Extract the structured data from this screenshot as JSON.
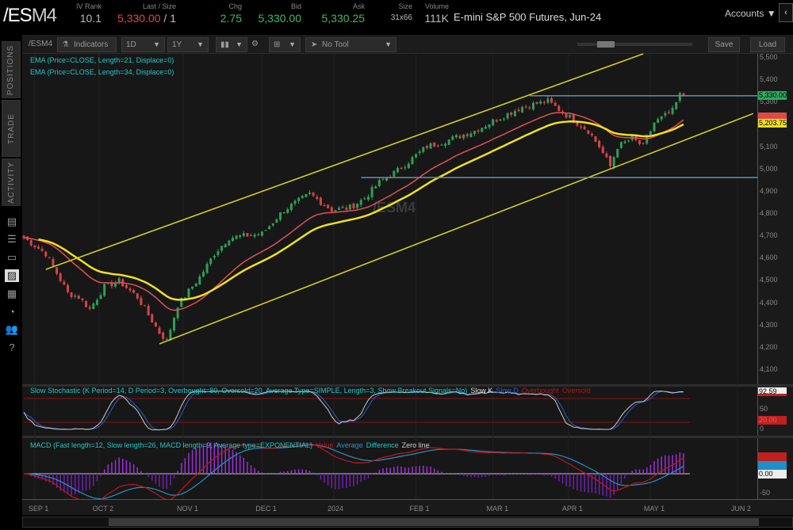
{
  "header": {
    "symbol_prefix": "/ES",
    "symbol_suffix": "M4",
    "fields": [
      {
        "label": "IV Rank",
        "value": "10.1"
      },
      {
        "label": "Last / Size",
        "value": "5,330.00",
        "suffix": " / 1"
      },
      {
        "label": "Chg",
        "value": "2.75"
      },
      {
        "label": "Bid",
        "value": "5,330.00"
      },
      {
        "label": "Ask",
        "value": "5,330.25"
      },
      {
        "label": "Size",
        "value": "31x66"
      },
      {
        "label": "Volume",
        "value": "111K"
      }
    ],
    "description": "E-mini S&P 500 Futures, Jun-24",
    "accounts": "Accounts"
  },
  "sidebar": {
    "tabs": [
      "POSITIONS",
      "TRADE",
      "ACTIVITY"
    ]
  },
  "toolbar": {
    "symbol": "/ESM4",
    "indicators": "Indicators",
    "aggregation": "1D",
    "range": "1Y",
    "tool": "No Tool",
    "save": "Save",
    "load": "Load"
  },
  "studies": {
    "ema21": "EMA (Price=CLOSE, Length=21, Displace=0)",
    "ema34": "EMA (Price=CLOSE, Length=34, Displace=0)",
    "stoch": "Slow Stochastic (K Period=14, D Period=3, Overbought=80, Oversold=20, Average Type=SIMPLE, Length=3, Show Breakout Signals=No)",
    "stoch_legend": [
      "Slow K",
      "Slow D",
      "Overbought",
      "Oversold"
    ],
    "macd": "MACD (Fast length=12, Slow length=26, MACD length=9, Average type=EXPONENTIAL)",
    "macd_legend": [
      "Value",
      "Average",
      "Difference",
      "Zero line"
    ],
    "watermark": "/ESM4"
  },
  "colors": {
    "up": "#2e9e5b",
    "down": "#d9434b",
    "ema21": "#e0505a",
    "ema34": "#f0e020",
    "channel": "#d8d820",
    "hline": "#6a90a8"
  },
  "chart_data": {
    "type": "candlestick",
    "x_unit": "trading day index",
    "close_keypoints": [
      [
        0,
        4693
      ],
      [
        6,
        4622
      ],
      [
        12,
        4445
      ],
      [
        15,
        4427
      ],
      [
        18,
        4373
      ],
      [
        22,
        4473
      ],
      [
        26,
        4498
      ],
      [
        31,
        4427
      ],
      [
        37,
        4267
      ],
      [
        39,
        4231
      ],
      [
        42,
        4391
      ],
      [
        48,
        4516
      ],
      [
        52,
        4622
      ],
      [
        56,
        4693
      ],
      [
        65,
        4711
      ],
      [
        71,
        4818
      ],
      [
        78,
        4889
      ],
      [
        84,
        4818
      ],
      [
        89,
        4828
      ],
      [
        93,
        4871
      ],
      [
        97,
        4942
      ],
      [
        102,
        4995
      ],
      [
        106,
        5049
      ],
      [
        110,
        5102
      ],
      [
        117,
        5138
      ],
      [
        123,
        5173
      ],
      [
        130,
        5233
      ],
      [
        136,
        5280
      ],
      [
        143,
        5305
      ],
      [
        148,
        5244
      ],
      [
        154,
        5173
      ],
      [
        157,
        5102
      ],
      [
        160,
        5013
      ],
      [
        162,
        5102
      ],
      [
        166,
        5138
      ],
      [
        169,
        5102
      ],
      [
        172,
        5209
      ],
      [
        177,
        5262
      ],
      [
        179,
        5333
      ],
      [
        180,
        5330
      ]
    ],
    "price_axis": {
      "ticks": [
        "5,500",
        "5,400",
        "5,300",
        "5,100",
        "5,000",
        "4,900",
        "4,800",
        "4,700",
        "4,600",
        "4,500",
        "4,400",
        "4,300",
        "4,200",
        "4,100"
      ],
      "range": [
        4070,
        5520
      ]
    },
    "price_tags": {
      "last": "5,330.00",
      "ema34": "5,203.75"
    },
    "date_ticks": [
      {
        "label": "SEP 1",
        "day": 3
      },
      {
        "label": "OCT 2",
        "day": 20.5
      },
      {
        "label": "NOV 1",
        "day": 43.5
      },
      {
        "label": "DEC 1",
        "day": 65
      },
      {
        "label": "2024",
        "day": 84.6
      },
      {
        "label": "FEB 1",
        "day": 107
      },
      {
        "label": "MAR 1",
        "day": 128
      },
      {
        "label": "APR 1",
        "day": 148.6
      },
      {
        "label": "MAY 1",
        "day": 170.9
      },
      {
        "label": "JUN 2",
        "day": 194.7
      }
    ],
    "channel_upper": [
      [
        6,
        4551
      ],
      [
        169,
        5518
      ]
    ],
    "channel_lower": [
      [
        37,
        4217
      ],
      [
        199,
        5250
      ]
    ],
    "hlines": [
      {
        "price": 5330,
        "from_day": 138
      },
      {
        "price": 4963,
        "from_day": 92
      }
    ],
    "stoch_axis": {
      "tag_k": "92.59",
      "tag_ob": "80",
      "mid": "50",
      "tag_os": "20.00",
      "zero": "0"
    },
    "macd_axis": {
      "tag_zero": "0.00",
      "low": "-50"
    }
  }
}
